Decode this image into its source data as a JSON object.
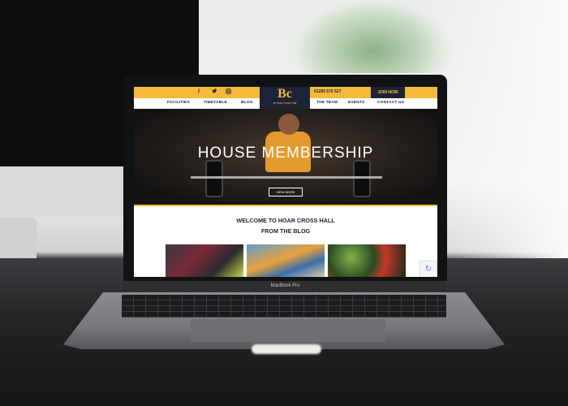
{
  "laptop": {
    "model_label": "MacBook Pro"
  },
  "site": {
    "social": [
      "facebook-icon",
      "twitter-icon",
      "instagram-icon"
    ],
    "phone": "01283 576 527",
    "join_label": "JOIN NOW",
    "logo": {
      "mark": "Bc",
      "subtitle": "at Hoar Cross Hall"
    },
    "nav_left": [
      "FACILITIES",
      "TIMETABLE",
      "BLOG"
    ],
    "nav_right": [
      "THE TEAM",
      "EVENTS",
      "CONTACT US"
    ],
    "hero": {
      "title": "HOUSE MEMBERSHIP",
      "button": "VIEW MORE"
    },
    "welcome_heading": "WELCOME TO HOAR CROSS HALL",
    "blog_heading": "FROM THE BLOG",
    "colors": {
      "accent": "#f6b93b",
      "navy": "#1d2336"
    }
  }
}
